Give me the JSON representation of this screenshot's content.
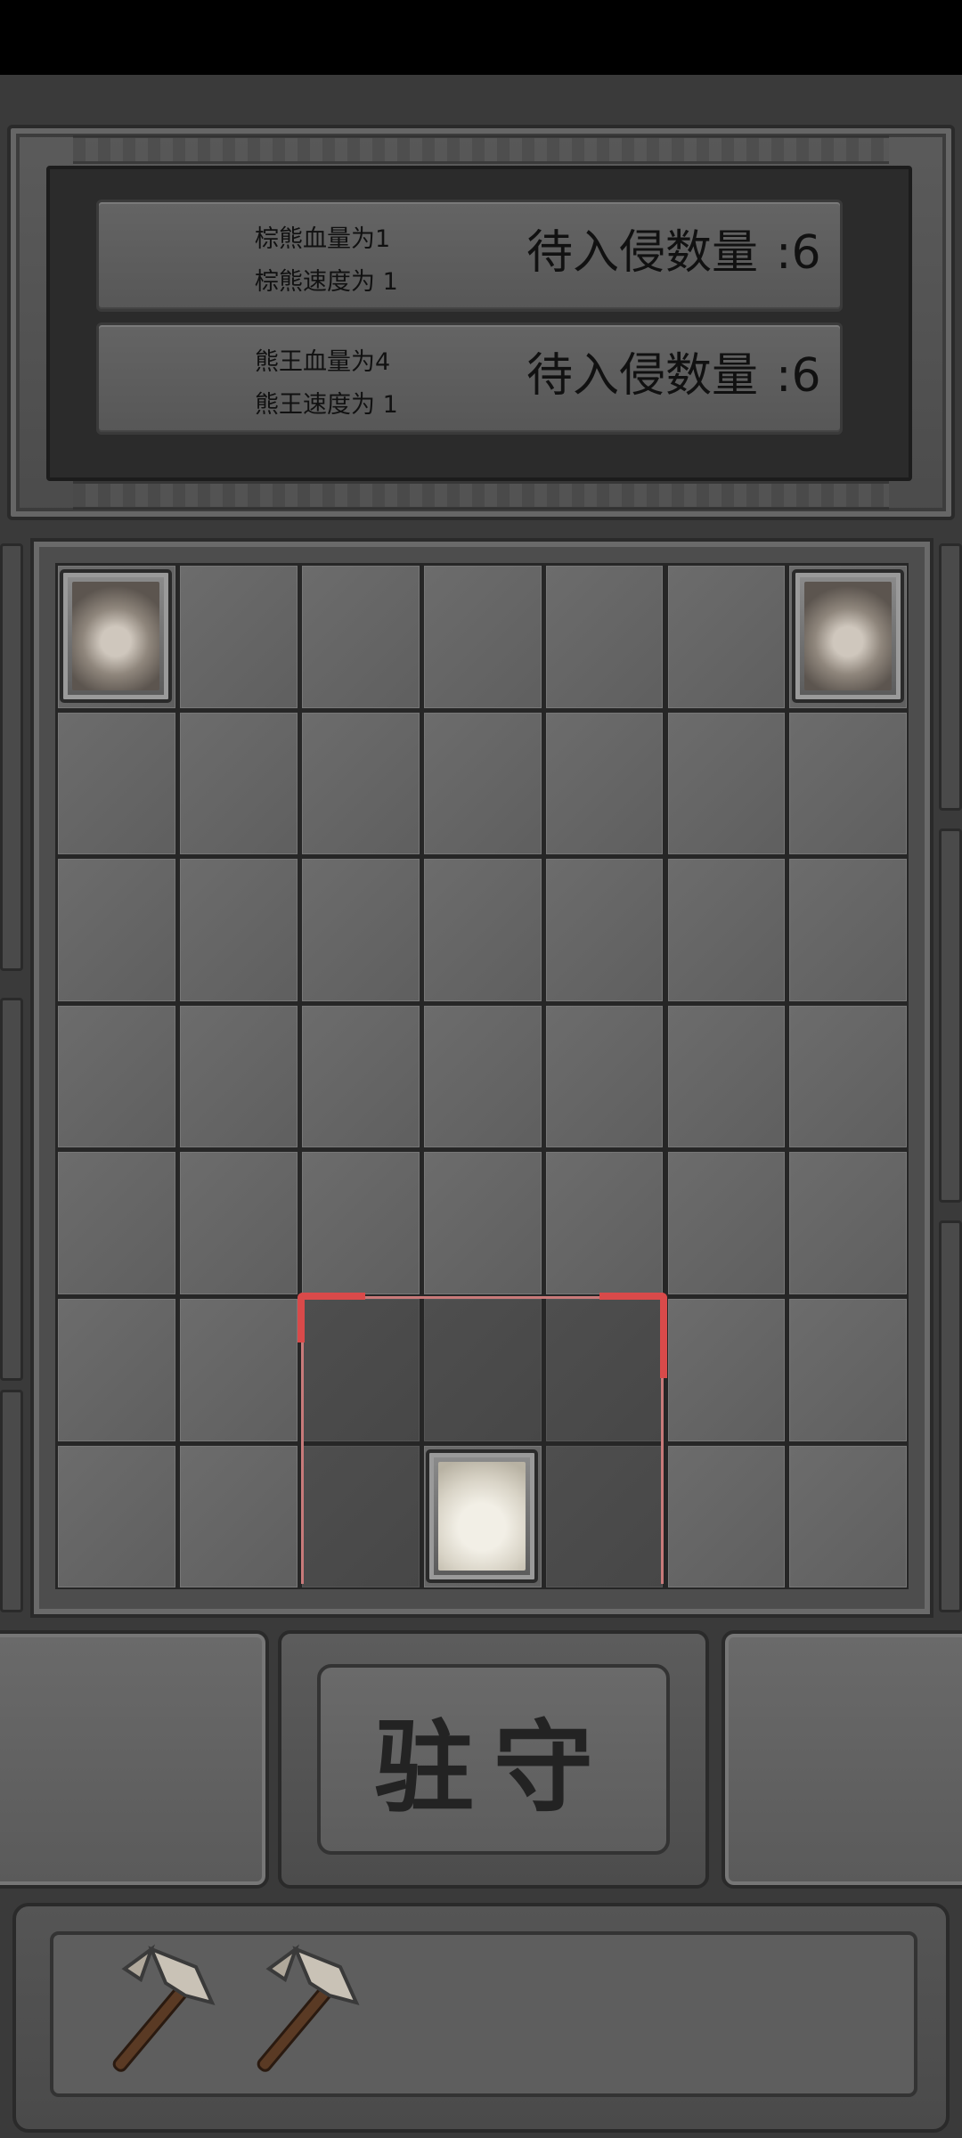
{
  "enemies": [
    {
      "hp_text": "棕熊血量为1",
      "speed_text": "棕熊速度为 1",
      "pending_label": "待入侵数量",
      "pending_value": ":6",
      "icon": "bear-icon"
    },
    {
      "hp_text": "熊王血量为4",
      "speed_text": "熊王速度为 1",
      "pending_label": "待入侵数量",
      "pending_value": ":6",
      "icon": "bear-king-icon"
    }
  ],
  "board": {
    "columns": 7,
    "rows": 7,
    "pieces": [
      {
        "name": "bear-piece",
        "icon": "bear-icon",
        "col": 1,
        "row": 1
      },
      {
        "name": "bear-piece",
        "icon": "bear-icon",
        "col": 7,
        "row": 1
      },
      {
        "name": "chef-piece",
        "icon": "chef-portrait-icon",
        "col": 4,
        "row": 7
      }
    ],
    "highlight_cells": [
      [
        3,
        6
      ],
      [
        4,
        6
      ],
      [
        5,
        6
      ],
      [
        3,
        7
      ],
      [
        5,
        7
      ]
    ],
    "range_color": "#d94a4a"
  },
  "action_button": {
    "label": "驻守"
  },
  "inventory": {
    "items": [
      "axe-icon",
      "axe-icon"
    ]
  }
}
